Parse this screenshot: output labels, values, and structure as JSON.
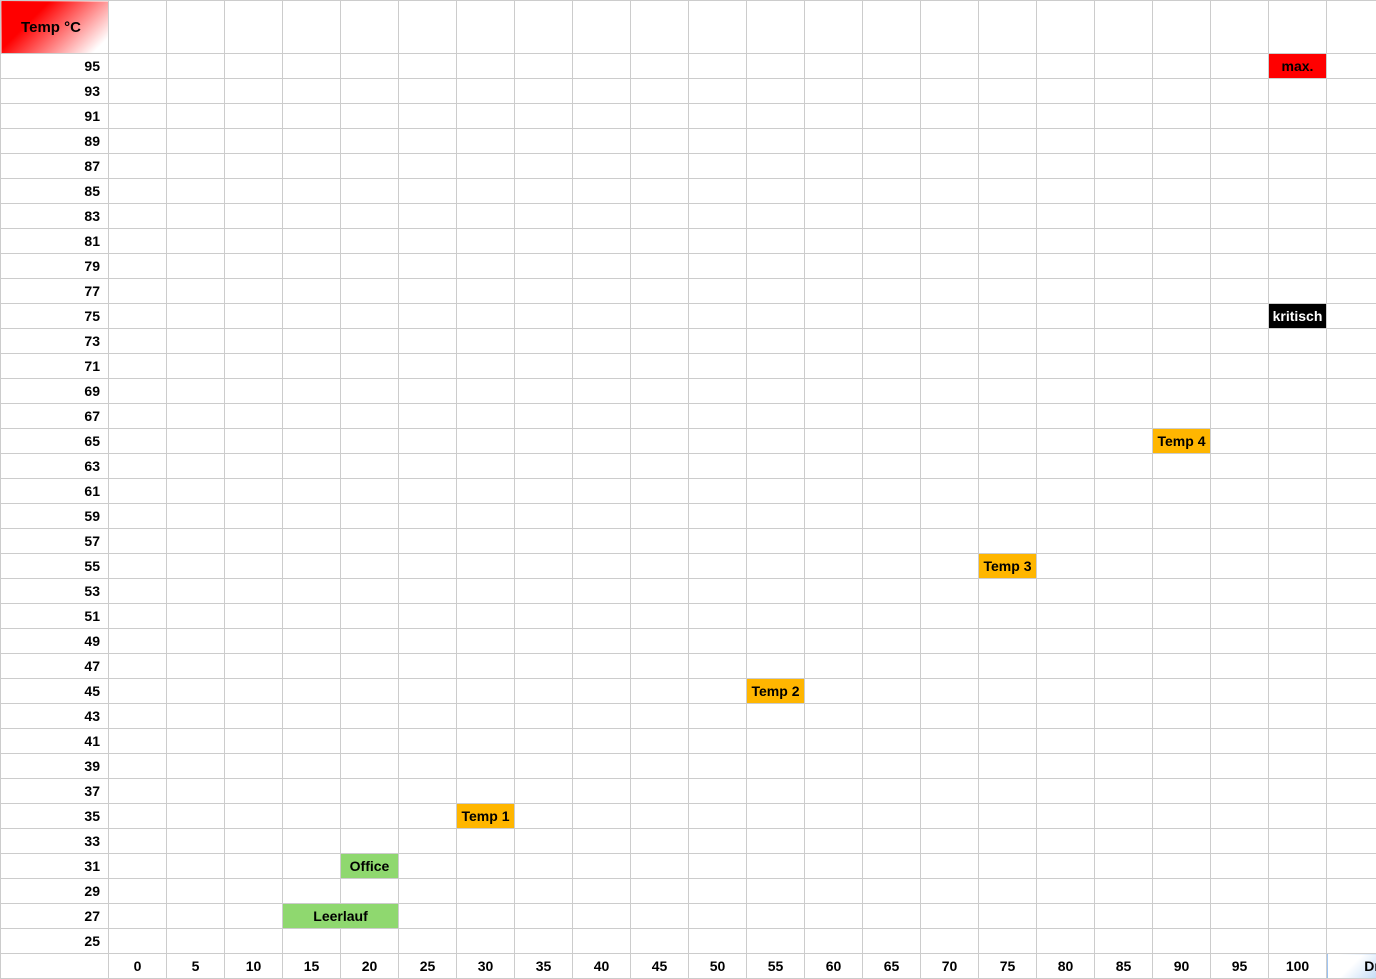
{
  "header": {
    "y_title": "Temp °C",
    "x_title": "Drehzahl %"
  },
  "y_values": [
    95,
    93,
    91,
    89,
    87,
    85,
    83,
    81,
    79,
    77,
    75,
    73,
    71,
    69,
    67,
    65,
    63,
    61,
    59,
    57,
    55,
    53,
    51,
    49,
    47,
    45,
    43,
    41,
    39,
    37,
    35,
    33,
    31,
    29,
    27,
    25
  ],
  "x_values": [
    0,
    5,
    10,
    15,
    20,
    25,
    30,
    35,
    40,
    45,
    50,
    55,
    60,
    65,
    70,
    75,
    80,
    85,
    90,
    95,
    100
  ],
  "markers": [
    {
      "label": "max.",
      "temp": 95,
      "rpm": 100,
      "style": "bar-red"
    },
    {
      "label": "kritisch",
      "temp": 75,
      "rpm": 100,
      "style": "bar-black"
    },
    {
      "label": "Temp 4",
      "temp": 65,
      "rpm": 90,
      "style": "bar-orange"
    },
    {
      "label": "Temp 3",
      "temp": 55,
      "rpm": 75,
      "style": "bar-orange"
    },
    {
      "label": "Temp 2",
      "temp": 45,
      "rpm": 55,
      "style": "bar-orange"
    },
    {
      "label": "Temp 1",
      "temp": 35,
      "rpm": 30,
      "style": "bar-orange"
    },
    {
      "label": "Office",
      "temp": 31,
      "rpm": 20,
      "style": "bar-green"
    },
    {
      "label": "Leerlauf",
      "temp": 27,
      "rpm": 15,
      "style": "bar-green",
      "span": 2
    }
  ],
  "chart_data": {
    "type": "scatter",
    "xlabel": "Drehzahl %",
    "ylabel": "Temp °C",
    "xlim": [
      0,
      100
    ],
    "ylim": [
      25,
      95
    ],
    "series": [
      {
        "name": "Leerlauf",
        "x": 15,
        "y": 27
      },
      {
        "name": "Office",
        "x": 20,
        "y": 31
      },
      {
        "name": "Temp 1",
        "x": 30,
        "y": 35
      },
      {
        "name": "Temp 2",
        "x": 55,
        "y": 45
      },
      {
        "name": "Temp 3",
        "x": 75,
        "y": 55
      },
      {
        "name": "Temp 4",
        "x": 90,
        "y": 65
      },
      {
        "name": "kritisch",
        "x": 100,
        "y": 75
      },
      {
        "name": "max.",
        "x": 100,
        "y": 95
      }
    ]
  }
}
